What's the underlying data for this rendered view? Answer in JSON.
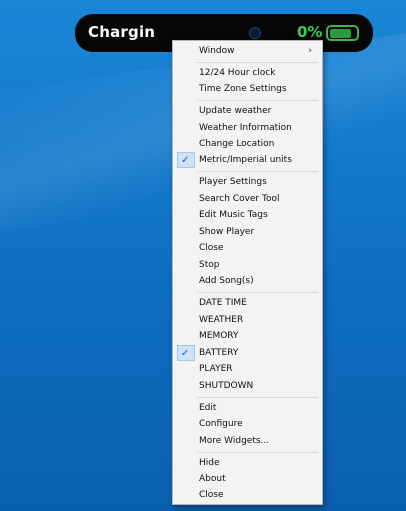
{
  "widget": {
    "title": "Chargin",
    "percent": "0%",
    "battery_fill": 0.8
  },
  "menu": {
    "window": "Window",
    "clock_12_24": "12/24 Hour clock",
    "time_zone_settings": "Time Zone Settings",
    "update_weather": "Update weather",
    "weather_information": "Weather Information",
    "change_location": "Change Location",
    "metric_imperial_units": "Metric/Imperial units",
    "player_settings": "Player Settings",
    "search_cover_tool": "Search Cover Tool",
    "edit_music_tags": "Edit Music Tags",
    "show_player": "Show Player",
    "close_player": "Close",
    "stop": "Stop",
    "add_songs": "Add Song(s)",
    "date_time": "DATE TIME",
    "weather": "WEATHER",
    "memory": "MEMORY",
    "battery": "BATTERY",
    "player": "PLAYER",
    "shutdown": "SHUTDOWN",
    "edit": "Edit",
    "configure": "Configure",
    "more_widgets": "More Widgets...",
    "hide": "Hide",
    "about": "About",
    "close": "Close"
  },
  "icons": {
    "submenu_arrow": "›",
    "checkmark": "✓"
  },
  "colors": {
    "percent_text": "#33d04e",
    "battery_border": "#49ad52",
    "checked_highlight": "#cde3f8"
  }
}
